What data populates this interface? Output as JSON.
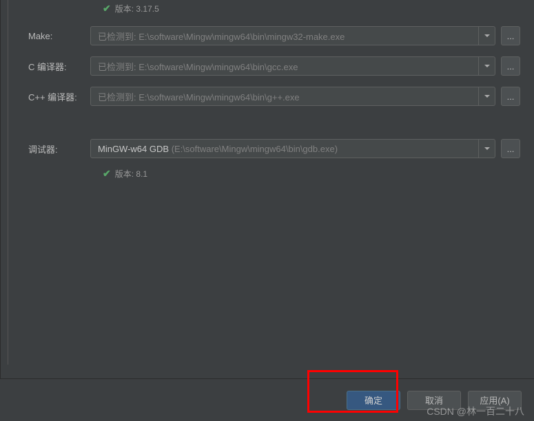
{
  "top_version": {
    "label": "版本: 3.17.5"
  },
  "fields": {
    "make": {
      "label": "Make:",
      "value": "已检测到: E:\\software\\Mingw\\mingw64\\bin\\mingw32-make.exe"
    },
    "c_compiler": {
      "label": "C 编译器:",
      "value": "已检测到: E:\\software\\Mingw\\mingw64\\bin\\gcc.exe"
    },
    "cpp_compiler": {
      "label": "C++ 编译器:",
      "value": "已检测到: E:\\software\\Mingw\\mingw64\\bin\\g++.exe"
    },
    "debugger": {
      "label": "调试器:",
      "name": "MinGW-w64 GDB",
      "path": "(E:\\software\\Mingw\\mingw64\\bin\\gdb.exe)"
    }
  },
  "debugger_version": {
    "label": "版本: 8.1"
  },
  "browse_label": "...",
  "buttons": {
    "ok": "确定",
    "cancel": "取消",
    "apply": "应用(A)"
  },
  "watermark": "CSDN @林一百二十八"
}
